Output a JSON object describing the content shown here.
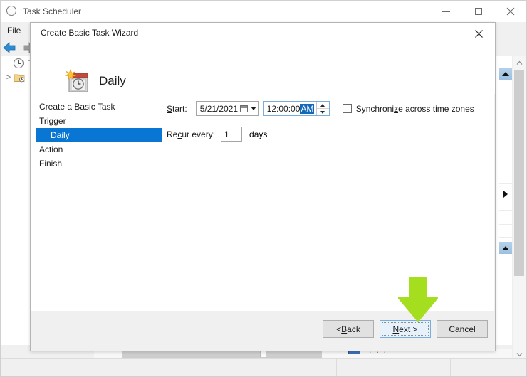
{
  "main_window": {
    "title": "Task Scheduler",
    "title_icon": "clock-icon",
    "controls": {
      "minimize": "minimize-icon",
      "maximize": "maximize-icon",
      "close": "close-icon"
    },
    "menubar": {
      "items": [
        "File"
      ]
    },
    "toolbar": {
      "back": "back-arrow-icon",
      "forward": "forward-arrow-icon"
    },
    "tree": {
      "root_label": "Tas",
      "child_expander": ">",
      "child_icon": "folder-clock-icon"
    },
    "scroll": {
      "pane_up_1": "triangle-up-icon",
      "pane_right": "triangle-right-icon",
      "pane_up_2": "triangle-up-icon",
      "window_up": "chevron-up-icon",
      "window_down": "chevron-down-icon"
    },
    "background_item": {
      "icon": "blue-task-icon",
      "dots": "..."
    }
  },
  "dialog": {
    "title": "Create Basic Task Wizard",
    "close_label": "✕",
    "heading": "Daily",
    "header_icon": "calendar-clock-star-icon",
    "nav": {
      "items": [
        {
          "label": "Create a Basic Task",
          "selected": false
        },
        {
          "label": "Trigger",
          "selected": false
        },
        {
          "label": "Daily",
          "selected": true
        },
        {
          "label": "Action",
          "selected": false
        },
        {
          "label": "Finish",
          "selected": false
        }
      ],
      "selected_color": "#0a76d4"
    },
    "form": {
      "start_label": "Start:",
      "start_label_accesskey": "S",
      "start_date_value": "5/21/2021",
      "start_date_icon": "calendar-icon",
      "start_date_caret": "chevron-down-icon",
      "start_time_value": "12:00:00 ",
      "start_time_ampm": "AM",
      "time_spinner": "spinner-updown-icon",
      "sync_checkbox_checked": false,
      "sync_label": "Synchronize across time zones",
      "recur_label": "Recur every:",
      "recur_value": "1",
      "recur_unit": "days"
    },
    "buttons": {
      "back": "< Back",
      "next": "Next >",
      "cancel": "Cancel",
      "default_button": "Next >"
    }
  },
  "annotation": {
    "arrow": "green-down-arrow",
    "color": "#A5DE1E"
  }
}
